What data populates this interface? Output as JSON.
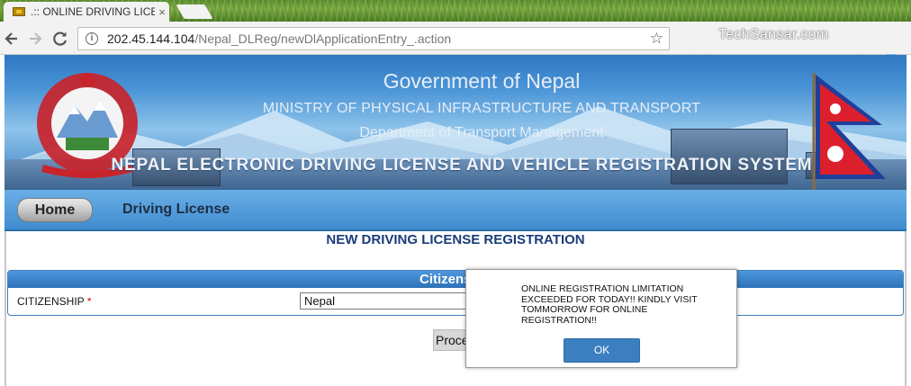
{
  "browser": {
    "tab_title": ".:: ONLINE DRIVING LICE",
    "tab_close": "×",
    "url_host": "202.45.144.104",
    "url_path": "/Nepal_DLReg/newDlApplicationEntry_.action",
    "watermark": "TechSansar.com",
    "icons": {
      "back": "back-arrow-icon",
      "forward": "forward-arrow-icon",
      "reload": "reload-icon",
      "info": "info-icon",
      "bookmark": "star-icon"
    }
  },
  "banner": {
    "gov_title": "Government of Nepal",
    "ministry": "MINISTRY OF PHYSICAL INFRASTRUCTURE AND TRANSPORT",
    "department": "Department of Transport Management",
    "system_name": "NEPAL ELECTRONIC DRIVING LICENSE AND VEHICLE REGISTRATION SYSTEM"
  },
  "menu": {
    "home": "Home",
    "driving_license": "Driving License"
  },
  "form": {
    "page_title": "NEW DRIVING LICENSE REGISTRATION",
    "section_title": "Citizenship",
    "citizenship_label": "CITIZENSHIP",
    "required_mark": "*",
    "citizenship_value": "Nepal",
    "proceed_label": "Proceed"
  },
  "dialog": {
    "message": "ONLINE REGISTRATION LIMITATION EXCEEDED FOR TODAY!! KINDLY VISIT TOMMORROW FOR ONLINE REGISTRATION!!",
    "ok_label": "OK"
  },
  "colors": {
    "banner_blue": "#4a94d6",
    "menu_blue": "#3f8ccf",
    "title_blue": "#1a3c7a",
    "ok_button": "#3b7fc0"
  }
}
